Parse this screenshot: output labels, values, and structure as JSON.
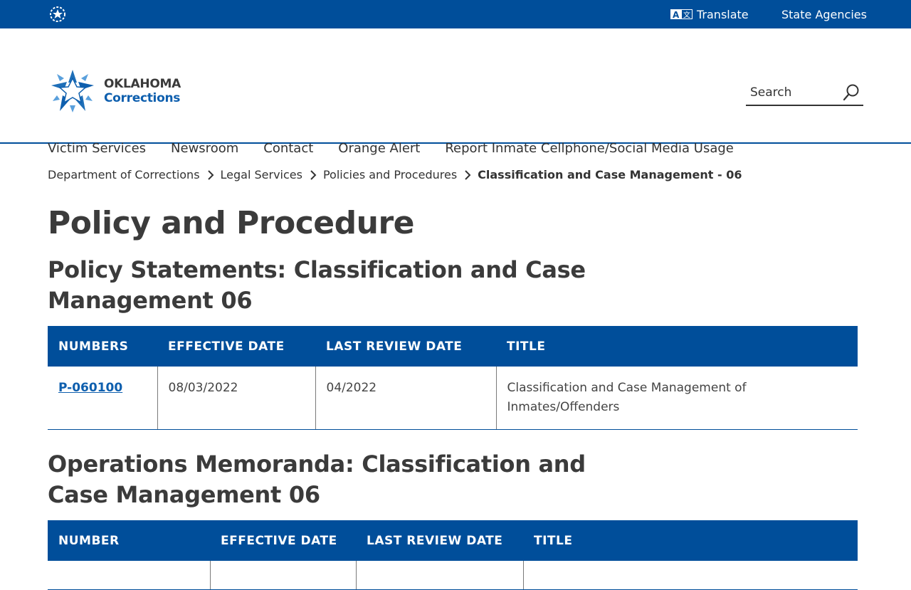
{
  "topbar": {
    "translate_label": "Translate",
    "agencies_label": "State Agencies",
    "translate_icon_text": "A文"
  },
  "logo": {
    "line1": "OKLAHOMA",
    "line2": "Corrections"
  },
  "search": {
    "placeholder": "Search"
  },
  "nav": {
    "items": [
      "Victim Services",
      "Newsroom",
      "Contact",
      "Orange Alert",
      "Report Inmate Cellphone/Social Media Usage"
    ]
  },
  "breadcrumb": {
    "items": [
      "Department of Corrections",
      "Legal Services",
      "Policies and Procedures"
    ],
    "current": "Classification and Case Management - 06"
  },
  "page": {
    "title": "Policy and Procedure"
  },
  "policy_statements": {
    "heading": "Policy Statements: Classification and Case Management 06",
    "columns": [
      "NUMBERS",
      "EFFECTIVE DATE",
      "LAST REVIEW DATE",
      "TITLE"
    ],
    "rows": [
      {
        "number": "P-060100",
        "effective_date": "08/03/2022",
        "last_review_date": "04/2022",
        "title": "Classification and Case Management of Inmates/Offenders"
      }
    ]
  },
  "operations_memoranda": {
    "heading": "Operations Memoranda: Classification and Case Management 06",
    "columns": [
      "NUMBER",
      "EFFECTIVE DATE",
      "LAST REVIEW DATE",
      "TITLE"
    ]
  },
  "colors": {
    "brand_blue": "#004e9a",
    "link_blue": "#0e5fae",
    "text_dark": "#3b3b3b"
  }
}
